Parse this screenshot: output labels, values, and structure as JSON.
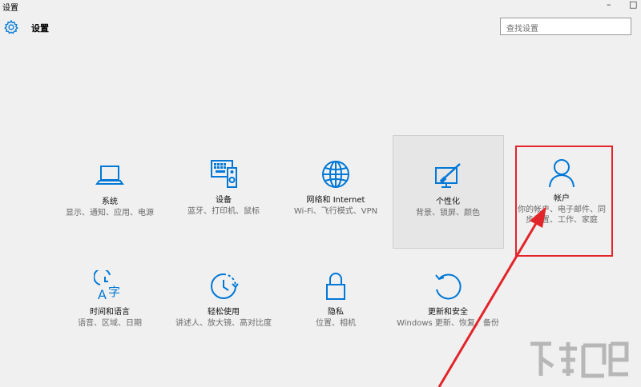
{
  "window": {
    "title": "设置",
    "minimize_glyph": "–",
    "maximize_glyph": "□"
  },
  "header": {
    "app_name": "设置",
    "search_placeholder": "查找设置"
  },
  "tiles": [
    {
      "label": "系统",
      "desc": "显示、通知、应用、电源",
      "icon": "laptop-icon"
    },
    {
      "label": "设备",
      "desc": "蓝牙、打印机、鼠标",
      "icon": "devices-icon"
    },
    {
      "label": "网络和 Internet",
      "desc": "Wi-Fi、飞行模式、VPN",
      "icon": "globe-icon"
    },
    {
      "label": "个性化",
      "desc": "背景、锁屏、颜色",
      "icon": "personalization-icon"
    },
    {
      "label": "帐户",
      "desc": "你的帐户、电子邮件、同步设置、工作、家庭",
      "icon": "person-icon"
    },
    {
      "label": "时间和语言",
      "desc": "语音、区域、日期",
      "icon": "time-language-icon"
    },
    {
      "label": "轻松使用",
      "desc": "讲述人、放大镜、高对比度",
      "icon": "ease-of-access-icon"
    },
    {
      "label": "隐私",
      "desc": "位置、相机",
      "icon": "lock-icon"
    },
    {
      "label": "更新和安全",
      "desc": "Windows 更新、恢复、备份",
      "icon": "update-icon"
    }
  ],
  "colors": {
    "accent": "#0078d7",
    "highlight": "#e2252a"
  }
}
